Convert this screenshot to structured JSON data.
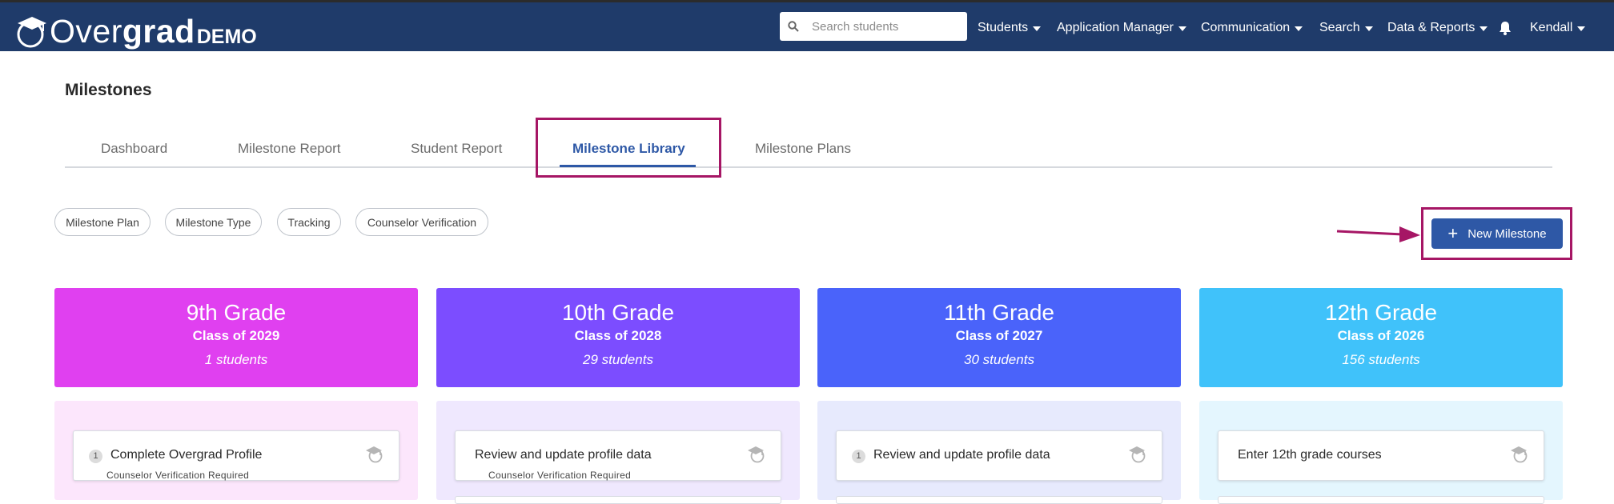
{
  "app": {
    "logo_text_light": "Over",
    "logo_text_bold": "grad",
    "logo_demo": "DEMO"
  },
  "nav": {
    "search_placeholder": "Search students",
    "items": [
      {
        "label": "Students"
      },
      {
        "label": "Application Manager"
      },
      {
        "label": "Communication"
      },
      {
        "label": "Search"
      },
      {
        "label": "Data & Reports"
      }
    ],
    "user": "Kendall"
  },
  "page": {
    "title": "Milestones",
    "tabs": [
      {
        "label": "Dashboard"
      },
      {
        "label": "Milestone Report"
      },
      {
        "label": "Student Report"
      },
      {
        "label": "Milestone Library",
        "active": true
      },
      {
        "label": "Milestone Plans"
      }
    ],
    "filters": [
      {
        "label": "Milestone Plan"
      },
      {
        "label": "Milestone Type"
      },
      {
        "label": "Tracking"
      },
      {
        "label": "Counselor Verification"
      }
    ],
    "new_button": "New Milestone"
  },
  "grades": [
    {
      "title": "9th Grade",
      "class": "Class of 2029",
      "count": "1 students",
      "color": "#e040f0",
      "bg": "#fce6fc",
      "milestone": {
        "num": "1",
        "title": "Complete Overgrad Profile",
        "sub": "Counselor Verification Required"
      }
    },
    {
      "title": "10th Grade",
      "class": "Class of 2028",
      "count": "29 students",
      "color": "#7c4dff",
      "bg": "#efe8fe",
      "milestone": {
        "num": "",
        "title": "Review and update profile data",
        "sub": "Counselor Verification Required"
      }
    },
    {
      "title": "11th Grade",
      "class": "Class of 2027",
      "count": "30 students",
      "color": "#4a63fa",
      "bg": "#e7eafd",
      "milestone": {
        "num": "1",
        "title": "Review and update profile data",
        "sub": ""
      }
    },
    {
      "title": "12th Grade",
      "class": "Class of 2026",
      "count": "156 students",
      "color": "#40c2fa",
      "bg": "#e4f6fe",
      "milestone": {
        "num": "",
        "title": "Enter 12th grade courses",
        "sub": ""
      }
    }
  ],
  "colors": {
    "navbar": "#1f3b6a",
    "accent": "#2e58a6",
    "highlight": "#a61665"
  }
}
